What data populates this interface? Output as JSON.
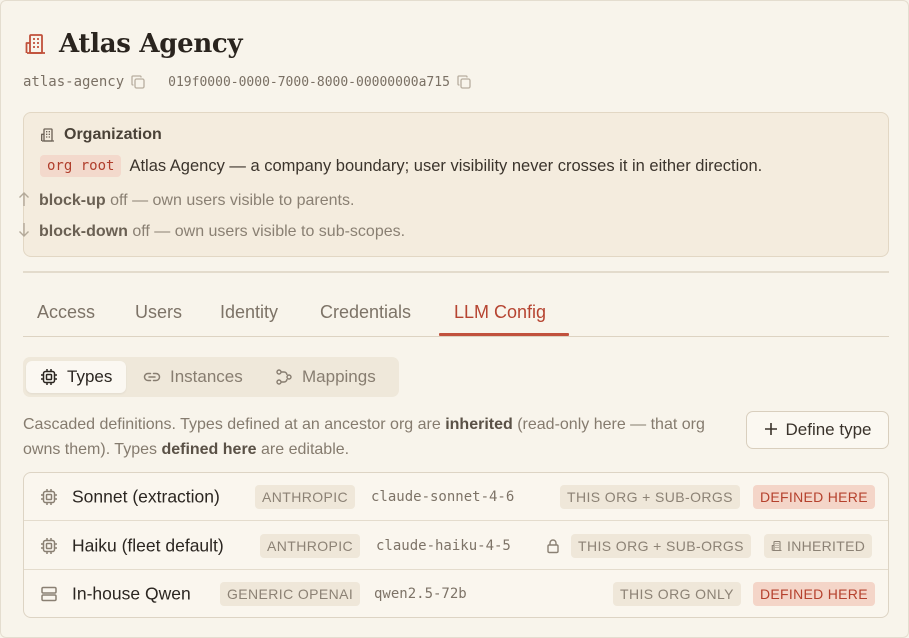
{
  "header": {
    "title": "Atlas Agency",
    "slug": "atlas-agency",
    "id": "019f0000-0000-7000-8000-00000000a715"
  },
  "organization": {
    "heading": "Organization",
    "root_chip": "org root",
    "description": "Atlas Agency — a company boundary; user visibility never crosses it in either direction.",
    "block_up_label": "block-up",
    "block_up_text": "off — own users visible to parents.",
    "block_down_label": "block-down",
    "block_down_text": "off — own users visible to sub-scopes."
  },
  "tabs": [
    {
      "label": "Access"
    },
    {
      "label": "Users"
    },
    {
      "label": "Identity"
    },
    {
      "label": "Credentials"
    },
    {
      "label": "LLM Config",
      "active": true
    }
  ],
  "subtabs": [
    {
      "label": "Types",
      "icon": "chip-icon",
      "active": true
    },
    {
      "label": "Instances",
      "icon": "link-icon"
    },
    {
      "label": "Mappings",
      "icon": "route-icon"
    }
  ],
  "description": {
    "part1": "Cascaded definitions. Types defined at an ancestor org are ",
    "bold1": "inherited",
    "part2": " (read-only here — that org owns them). Types ",
    "bold2": "defined here",
    "part3": " are editable."
  },
  "define_button": "Define type",
  "types": [
    {
      "name": "Sonnet (extraction)",
      "provider": "ANTHROPIC",
      "model": "claude-sonnet-4-6",
      "scope": "THIS ORG + SUB-ORGS",
      "status": "DEFINED HERE",
      "icon": "chip-icon",
      "locked": false
    },
    {
      "name": "Haiku (fleet default)",
      "provider": "ANTHROPIC",
      "model": "claude-haiku-4-5",
      "scope": "THIS ORG + SUB-ORGS",
      "status": "INHERITED",
      "icon": "chip-icon",
      "locked": true
    },
    {
      "name": "In-house Qwen",
      "provider": "GENERIC OPENAI",
      "model": "qwen2.5-72b",
      "scope": "THIS ORG ONLY",
      "status": "DEFINED HERE",
      "icon": "server-icon",
      "locked": false
    }
  ],
  "colors": {
    "accent": "#c1513d",
    "background": "#f8f4eb",
    "defined_here_bg": "#f4d5c8",
    "tag_bg": "#efe7d9"
  }
}
